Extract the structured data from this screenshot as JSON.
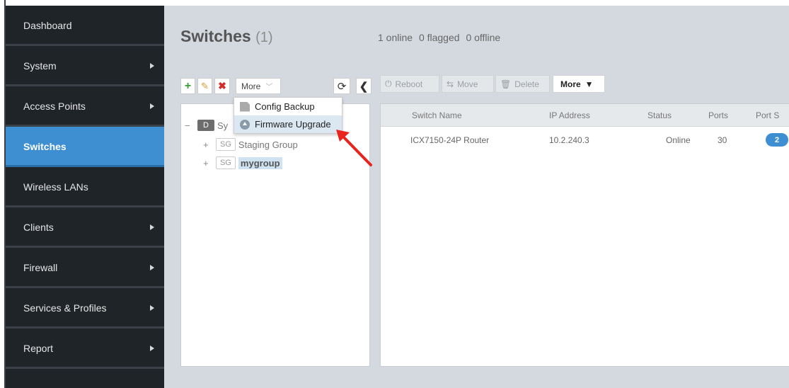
{
  "sidebar": {
    "items": [
      {
        "label": "Dashboard",
        "arrow": false,
        "active": false
      },
      {
        "label": "System",
        "arrow": true,
        "active": false
      },
      {
        "label": "Access Points",
        "arrow": true,
        "active": false
      },
      {
        "label": "Switches",
        "arrow": false,
        "active": true
      },
      {
        "label": "Wireless LANs",
        "arrow": false,
        "active": false
      },
      {
        "label": "Clients",
        "arrow": true,
        "active": false
      },
      {
        "label": "Firewall",
        "arrow": true,
        "active": false
      },
      {
        "label": "Services & Profiles",
        "arrow": true,
        "active": false
      },
      {
        "label": "Report",
        "arrow": true,
        "active": false
      }
    ]
  },
  "header": {
    "title": "Switches",
    "count": "(1)",
    "online": "1 online",
    "flagged": "0 flagged",
    "offline": "0 offline"
  },
  "tree_toolbar": {
    "add_icon": "plus-icon",
    "edit_icon": "pencil-icon",
    "delete_icon": "x-icon",
    "more_label": "More",
    "refresh_icon": "refresh-icon",
    "collapse_icon": "chevron-left-icon"
  },
  "more_menu": {
    "items": [
      {
        "label": "Config Backup",
        "icon": "document-icon"
      },
      {
        "label": "Firmware Upgrade",
        "icon": "upload-circle-icon"
      }
    ]
  },
  "tree": {
    "root": {
      "toggle": "−",
      "badge": "D",
      "label": "Sy"
    },
    "children": [
      {
        "toggle": "+",
        "badge": "SG",
        "label": "Staging Group"
      },
      {
        "toggle": "+",
        "badge": "SG",
        "label": "mygroup"
      }
    ]
  },
  "actions": {
    "reboot": "Reboot",
    "move": "Move",
    "delete": "Delete",
    "more": "More"
  },
  "table": {
    "columns": [
      "Switch Name",
      "IP Address",
      "Status",
      "Ports",
      "Port S"
    ],
    "rows": [
      {
        "name": "ICX7150-24P Router",
        "ip": "10.2.240.3",
        "status": "Online",
        "ports": "30",
        "port_badge": "2"
      }
    ]
  },
  "colors": {
    "accent": "#3d8fd1",
    "sidebar_bg": "#1f2429",
    "annotation_arrow": "#e8241c"
  }
}
